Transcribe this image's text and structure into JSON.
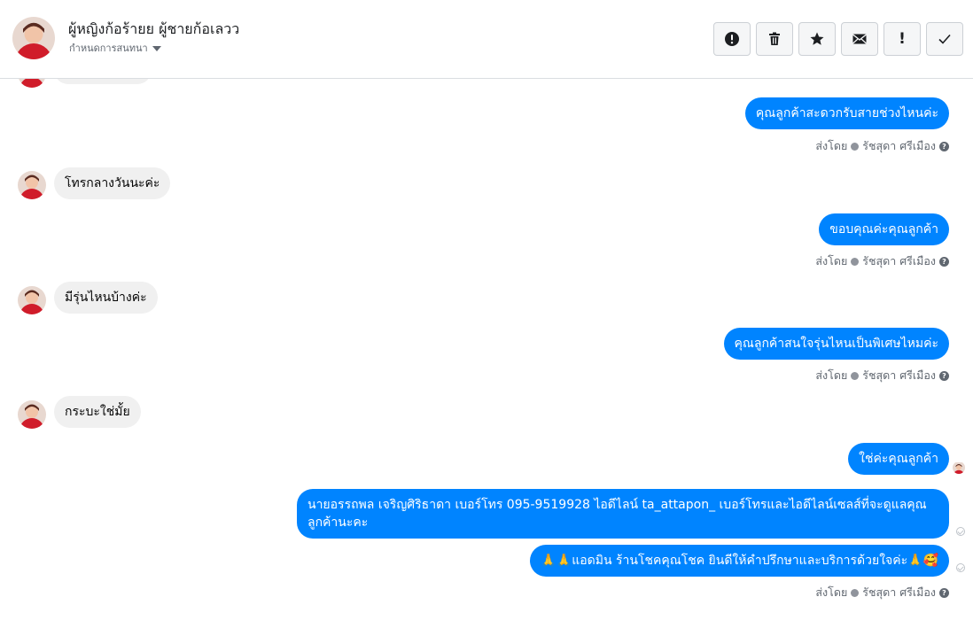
{
  "conversation": {
    "contact_name": "ผู้หญิงก้อร้ายย ผู้ชายก้อเลวว",
    "assign_label": "กำหนดการสนทนา"
  },
  "toolbar": {
    "icons": [
      "alert-circle-icon",
      "trash-icon",
      "star-icon",
      "envelope-icon",
      "exclamation-icon",
      "check-icon"
    ],
    "spam_label": "!"
  },
  "messages": {
    "m1": "คุณลูกค้าสะดวกรับสายช่วงไหนค่ะ",
    "m2": "โทรกลางวันนะค่ะ",
    "m3": "ขอบคุณค่ะคุณลูกค้า",
    "m4": "มีรุ่นไหนบ้างค่ะ",
    "m5": "คุณลูกค้าสนใจรุ่นไหนเป็นพิเศษไหมค่ะ",
    "m6": "กระบะใช่มั้ย",
    "m7": "ใช่ค่ะคุณลูกค้า",
    "m8": "นายอรรถพล เจริญศิริธาดา     เบอร์โทร 095-9519928 ไอดีไลน์ ta_attapon_   เบอร์โทรและไอดีไลน์เซลส์ที่จะดูแลคุณลูกค้านะคะ",
    "m9": "🙏🙏แอดมิน ร้านโชคคุณโชค ยินดีให้คำปรึกษาและบริการด้วยใจค่ะ🙏🥰"
  },
  "meta": {
    "sent_by": "ส่งโดย",
    "agent": "รัชสุดา ศรีเมือง",
    "help": "?"
  },
  "colors": {
    "outgoing": "#0084ff",
    "incoming": "#f0f0f0",
    "header_border": "#dadde1"
  }
}
